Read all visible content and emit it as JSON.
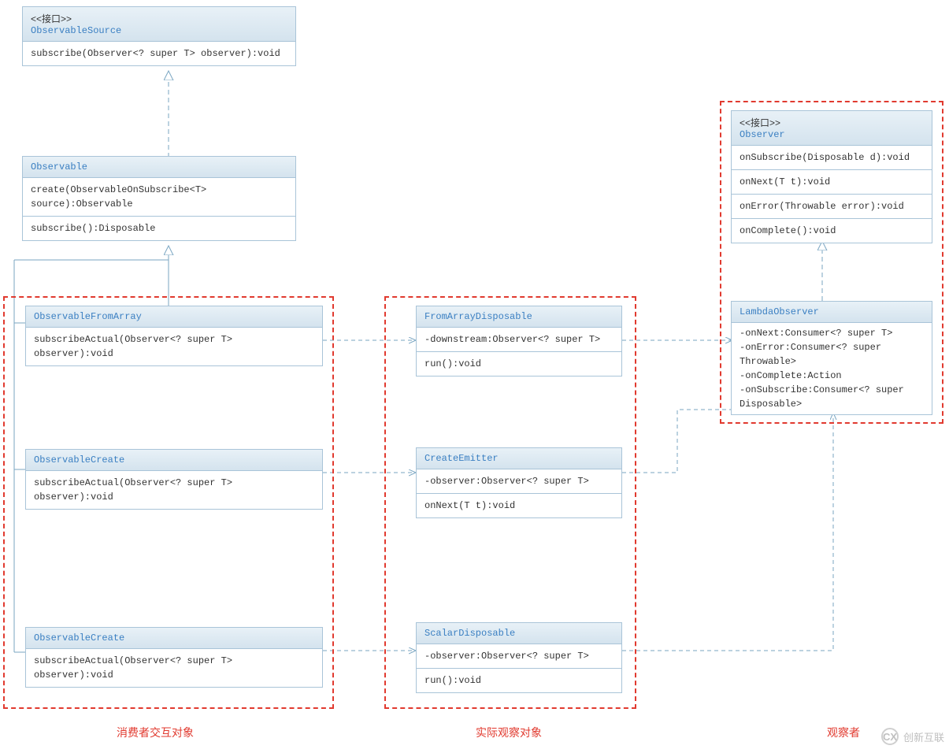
{
  "boxes": {
    "observableSource": {
      "stereo": "<<接口>>",
      "title": "ObservableSource",
      "rows": [
        "subscribe(Observer<? super T> observer):void"
      ]
    },
    "observable": {
      "title": "Observable",
      "rows": [
        "create(ObservableOnSubscribe<T> source):Observable",
        "subscribe():Disposable"
      ]
    },
    "observableFromArray": {
      "title": "ObservableFromArray",
      "rows": [
        "subscribeActual(Observer<? super T> observer):void"
      ]
    },
    "observableCreate1": {
      "title": "ObservableCreate",
      "rows": [
        "subscribeActual(Observer<? super T> observer):void"
      ]
    },
    "observableCreate2": {
      "title": "ObservableCreate",
      "rows": [
        "subscribeActual(Observer<? super T> observer):void"
      ]
    },
    "fromArrayDisposable": {
      "title": "FromArrayDisposable",
      "rows": [
        "-downstream:Observer<? super T>",
        "run():void"
      ]
    },
    "createEmitter": {
      "title": "CreateEmitter",
      "rows": [
        "-observer:Observer<? super T>",
        "onNext(T t):void"
      ]
    },
    "scalarDisposable": {
      "title": "ScalarDisposable",
      "rows": [
        "-observer:Observer<? super T>",
        "run():void"
      ]
    },
    "observer": {
      "stereo": "<<接口>>",
      "title": "Observer",
      "rows": [
        "onSubscribe(Disposable d):void",
        "onNext(T t):void",
        "onError(Throwable error):void",
        "onComplete():void"
      ]
    },
    "lambdaObserver": {
      "title": "LambdaObserver",
      "rows": [
        "-onNext:Consumer<? super T>",
        "-onError:Consumer<? super Throwable>",
        "-onComplete:Action",
        "-onSubscribe:Consumer<? super Disposable>"
      ]
    }
  },
  "groups": {
    "consumer": "消费者交互对象",
    "actual": "实际观察对象",
    "observer": "观察者"
  },
  "watermark": {
    "badge": "CX",
    "text": "创新互联"
  }
}
